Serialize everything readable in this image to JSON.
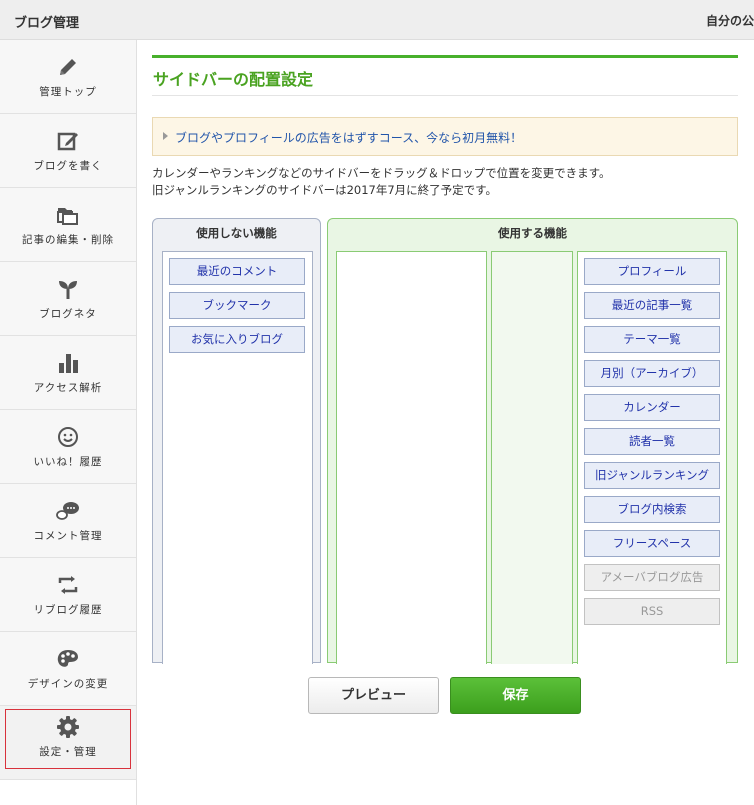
{
  "header": {
    "title": "ブログ管理",
    "right_text": "自分の公開"
  },
  "sidebar": {
    "items": [
      {
        "label": "管理トップ",
        "icon": "pencil-icon"
      },
      {
        "label": "ブログを書く",
        "icon": "compose-icon"
      },
      {
        "label": "記事の編集・削除",
        "icon": "folders-icon"
      },
      {
        "label": "ブログネタ",
        "icon": "sprout-icon"
      },
      {
        "label": "アクセス解析",
        "icon": "bar-chart-icon"
      },
      {
        "label": "いいね！履歴",
        "icon": "smiley-icon"
      },
      {
        "label": "コメント管理",
        "icon": "chat-icon"
      },
      {
        "label": "リブログ履歴",
        "icon": "reblog-icon"
      },
      {
        "label": "デザインの変更",
        "icon": "palette-icon"
      },
      {
        "label": "設定・管理",
        "icon": "gear-icon",
        "active": true
      }
    ]
  },
  "main": {
    "title": "サイドバーの配置設定",
    "promo": "ブログやプロフィールの広告をはずすコース、今なら初月無料！",
    "desc_line1": "カレンダーやランキングなどのサイドバーをドラッグ＆ドロップで位置を変更できます。",
    "desc_line2": "旧ジャンルランキングのサイドバーは2017年7月に終了予定です。",
    "unused": {
      "heading": "使用しない機能",
      "modules": [
        "最近のコメント",
        "ブックマーク",
        "お気に入りブログ"
      ]
    },
    "used": {
      "heading": "使用する機能",
      "modules": [
        "プロフィール",
        "最近の記事一覧",
        "テーマ一覧",
        "月別（アーカイブ）",
        "カレンダー",
        "読者一覧",
        "旧ジャンルランキング",
        "ブログ内検索",
        "フリースペース"
      ],
      "disabled_modules": [
        "アメーバブログ広告",
        "RSS"
      ]
    },
    "preview_label": "プレビュー",
    "save_label": "保存"
  },
  "colors": {
    "accent": "#47b02b",
    "promo_link": "#2255aa",
    "module_text": "#2233aa",
    "active_border": "#d8323c"
  }
}
